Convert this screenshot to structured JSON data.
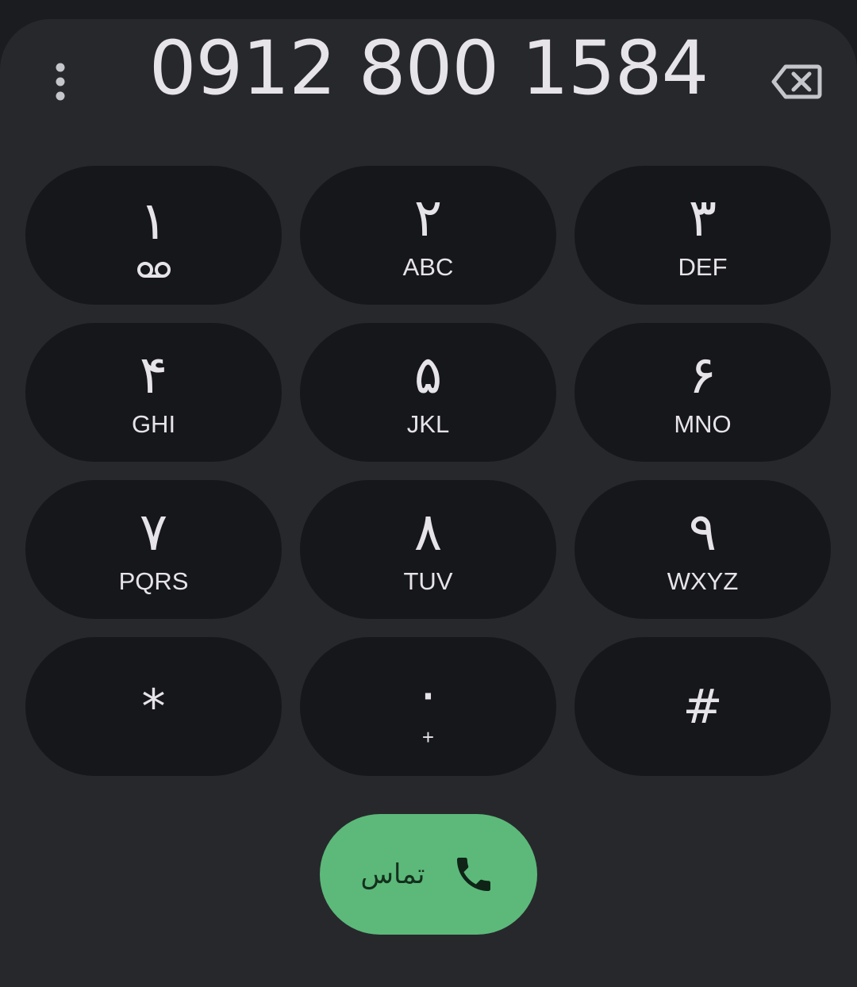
{
  "header": {
    "menu_icon": "more-vert-icon",
    "dialed_number": "0912 800 1584",
    "backspace_icon": "backspace-icon"
  },
  "keypad": {
    "keys": [
      {
        "digit": "۱",
        "letters": "",
        "icon": "voicemail-icon"
      },
      {
        "digit": "۲",
        "letters": "ABC"
      },
      {
        "digit": "۳",
        "letters": "DEF"
      },
      {
        "digit": "۴",
        "letters": "GHI"
      },
      {
        "digit": "۵",
        "letters": "JKL"
      },
      {
        "digit": "۶",
        "letters": "MNO"
      },
      {
        "digit": "۷",
        "letters": "PQRS"
      },
      {
        "digit": "۸",
        "letters": "TUV"
      },
      {
        "digit": "۹",
        "letters": "WXYZ"
      },
      {
        "digit": "*",
        "letters": ""
      },
      {
        "digit": "۰",
        "letters": "+"
      },
      {
        "digit": "#",
        "letters": ""
      }
    ]
  },
  "call": {
    "label": "تماس",
    "icon": "phone-icon",
    "color": "#5cb97a"
  },
  "colors": {
    "background": "#27282c",
    "key_background": "#16171b",
    "text": "#e6e4e9"
  }
}
